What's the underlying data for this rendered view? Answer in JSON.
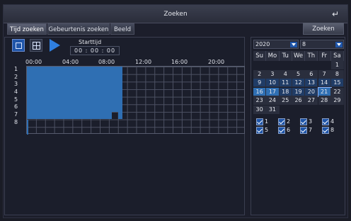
{
  "window": {
    "title": "Zoeken",
    "back_icon": "back-arrow-icon"
  },
  "tabs": [
    {
      "label": "Tijd zoeken",
      "active": true
    },
    {
      "label": "Gebeurtenis zoeken",
      "active": false
    },
    {
      "label": "Beeld",
      "active": false
    }
  ],
  "search_button": "Zoeken",
  "toolbar": {
    "single_view_icon": "single-view-icon",
    "quad_view_icon": "quad-view-icon",
    "play_icon": "play-icon",
    "start_label": "Starttijd",
    "start_time": "00 : 00 : 00"
  },
  "timeline": {
    "hours": [
      "00:00",
      "04:00",
      "08:00",
      "12:00",
      "16:00",
      "20:00"
    ],
    "channels": [
      "1",
      "2",
      "3",
      "4",
      "5",
      "6",
      "7",
      "8"
    ],
    "recording_color": "#2f6fb3"
  },
  "calendar": {
    "year": "2020",
    "month": "8",
    "weekdays": [
      "Su",
      "Mo",
      "Tu",
      "We",
      "Th",
      "Fr",
      "Sa"
    ],
    "days": [
      "1",
      "2",
      "3",
      "4",
      "5",
      "6",
      "7",
      "8",
      "9",
      "10",
      "11",
      "12",
      "13",
      "14",
      "15",
      "16",
      "17",
      "18",
      "19",
      "20",
      "21",
      "22",
      "23",
      "24",
      "25",
      "26",
      "27",
      "28",
      "29",
      "30",
      "31"
    ],
    "first_weekday_index": 6,
    "recorded_days": [
      9,
      10,
      11,
      12,
      13,
      14,
      15
    ],
    "selected_day": 21,
    "highlight_days": [
      16,
      17,
      18,
      19,
      20,
      21
    ]
  },
  "channel_checks": [
    {
      "label": "1",
      "checked": true
    },
    {
      "label": "2",
      "checked": true
    },
    {
      "label": "3",
      "checked": true
    },
    {
      "label": "4",
      "checked": true
    },
    {
      "label": "5",
      "checked": true
    },
    {
      "label": "6",
      "checked": true
    },
    {
      "label": "7",
      "checked": true
    },
    {
      "label": "8",
      "checked": true
    }
  ]
}
